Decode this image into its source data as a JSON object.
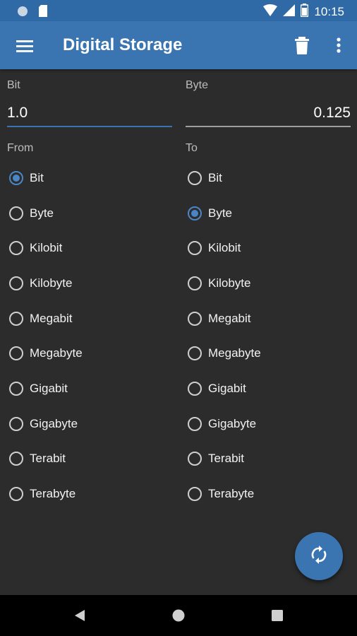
{
  "status_bar": {
    "time": "10:15"
  },
  "app_bar": {
    "title": "Digital Storage"
  },
  "from_field": {
    "label": "Bit",
    "value": "1.0"
  },
  "to_field": {
    "label": "Byte",
    "value": "0.125"
  },
  "from_group": {
    "label": "From",
    "selected": "Bit",
    "items": [
      "Bit",
      "Byte",
      "Kilobit",
      "Kilobyte",
      "Megabit",
      "Megabyte",
      "Gigabit",
      "Gigabyte",
      "Terabit",
      "Terabyte"
    ]
  },
  "to_group": {
    "label": "To",
    "selected": "Byte",
    "items": [
      "Bit",
      "Byte",
      "Kilobit",
      "Kilobyte",
      "Megabit",
      "Megabyte",
      "Gigabit",
      "Gigabyte",
      "Terabit",
      "Terabyte"
    ]
  },
  "colors": {
    "primary": "#3a75b2",
    "status_bar": "#2f6aa7",
    "background": "#2c2c2c",
    "accent": "#4a86c5"
  },
  "icons": {
    "menu": "menu-icon",
    "trash": "trash-icon",
    "more": "more-vert-icon",
    "swap": "swap-icon",
    "back": "back-icon",
    "home": "home-icon",
    "recents": "recents-icon"
  }
}
